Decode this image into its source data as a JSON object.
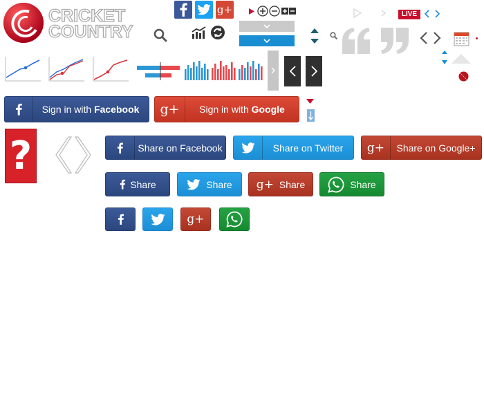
{
  "logo": {
    "line1": "CRICKET",
    "line2": "COUNTRY"
  },
  "header": {
    "live_badge": "LIVE"
  },
  "signin": {
    "facebook_prefix": "Sign in with ",
    "facebook_name": "Facebook",
    "google_prefix": "Sign in with ",
    "google_name": "Google"
  },
  "share_large": {
    "facebook": "Share on Facebook",
    "twitter": "Share on Twitter",
    "google": "Share on Google+"
  },
  "share_medium": {
    "facebook": "Share",
    "twitter": "Share",
    "google": "Share",
    "whatsapp": "Share"
  },
  "colors": {
    "facebook": "#3b5998",
    "twitter": "#1da1f2",
    "google": "#dd4b39",
    "whatsapp": "#17a43a",
    "live": "#c8102e",
    "blue_dropdown": "#1a8ed2"
  },
  "icons": [
    "cricket-ball-logo-icon",
    "search-icon",
    "facebook-icon",
    "twitter-icon",
    "google-plus-icon",
    "play-icon",
    "zoom-in-icon",
    "zoom-out-icon",
    "plus-icon",
    "minus-icon",
    "chart-icon",
    "refresh-icon",
    "chevron-down-icon",
    "sort-arrows-icon",
    "quote-open-icon",
    "quote-close-icon",
    "chevron-left-icon",
    "chevron-right-icon",
    "calendar-icon",
    "whatsapp-icon",
    "question-icon",
    "cricket-ball-icon"
  ]
}
